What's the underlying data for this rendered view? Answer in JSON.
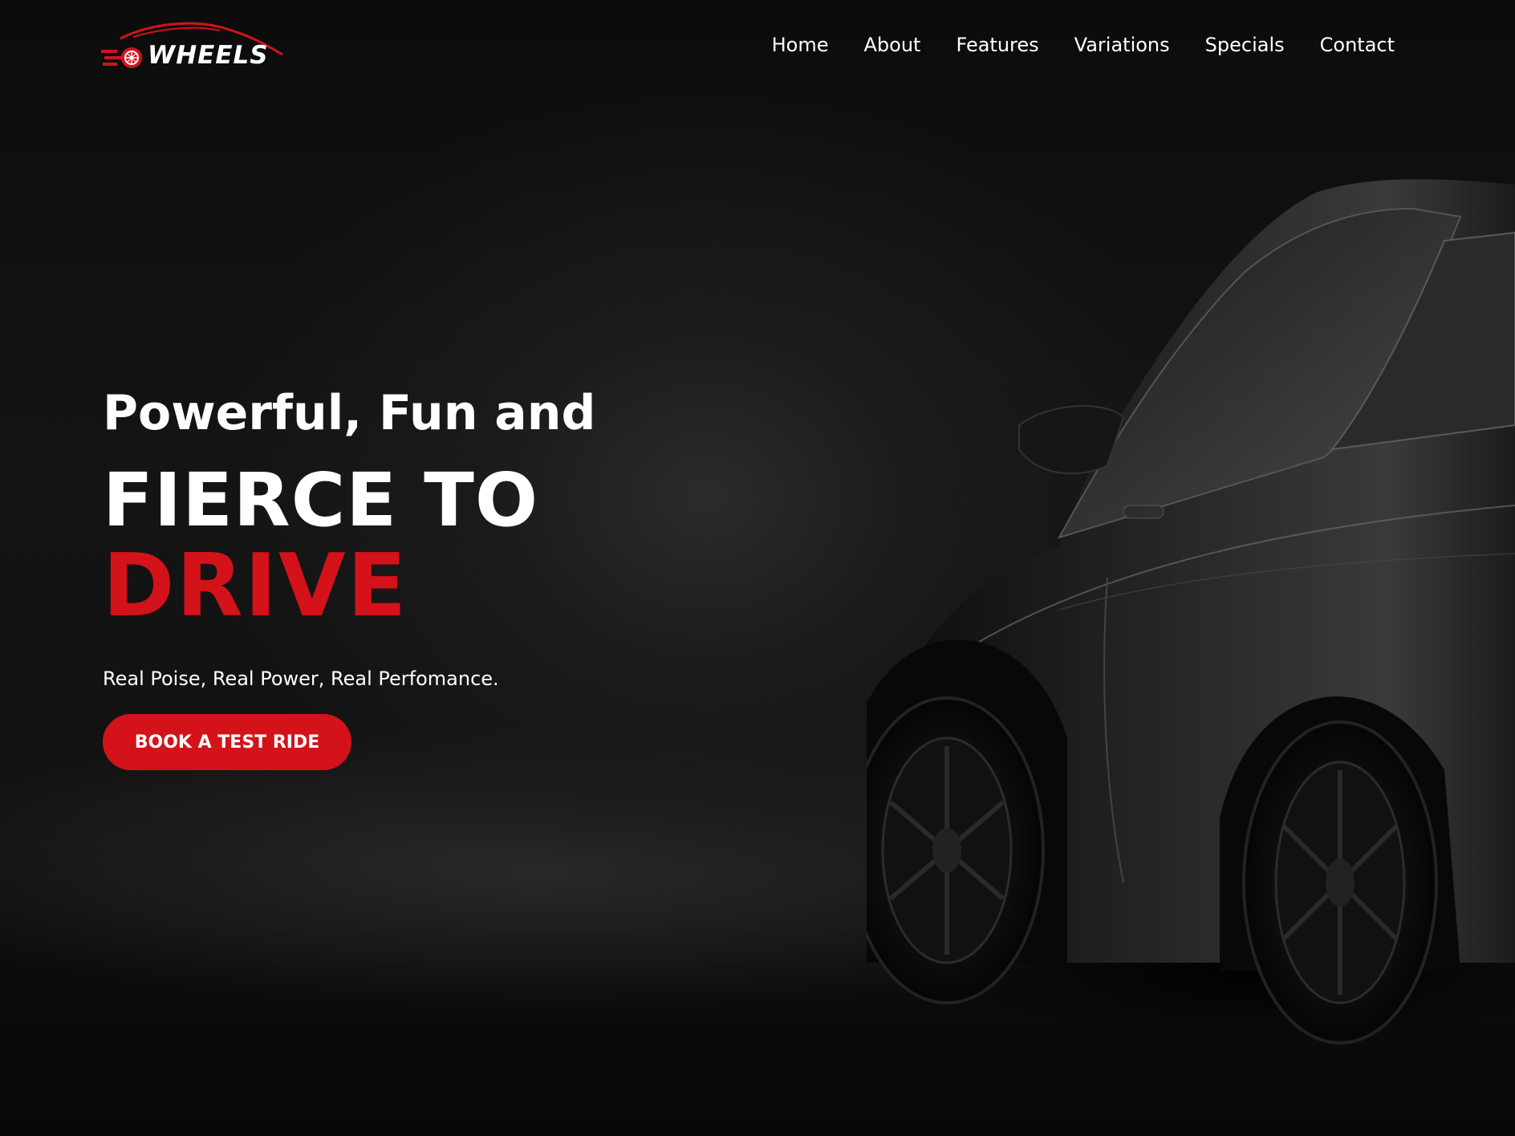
{
  "brand": {
    "name": "WHEELS",
    "logo_icon": "wheel-car-logo-icon",
    "accent_color": "#d4121a"
  },
  "nav": {
    "items": [
      {
        "label": "Home"
      },
      {
        "label": "About"
      },
      {
        "label": "Features"
      },
      {
        "label": "Variations"
      },
      {
        "label": "Specials"
      },
      {
        "label": "Contact"
      }
    ]
  },
  "hero": {
    "tagline": "Powerful, Fun and",
    "headline": "FIERCE TO",
    "headline_accent": "DRIVE",
    "subtext": "Real Poise, Real Power, Real Perfomance.",
    "cta_label": "BOOK A TEST RIDE",
    "image": "black-sports-car-image"
  }
}
